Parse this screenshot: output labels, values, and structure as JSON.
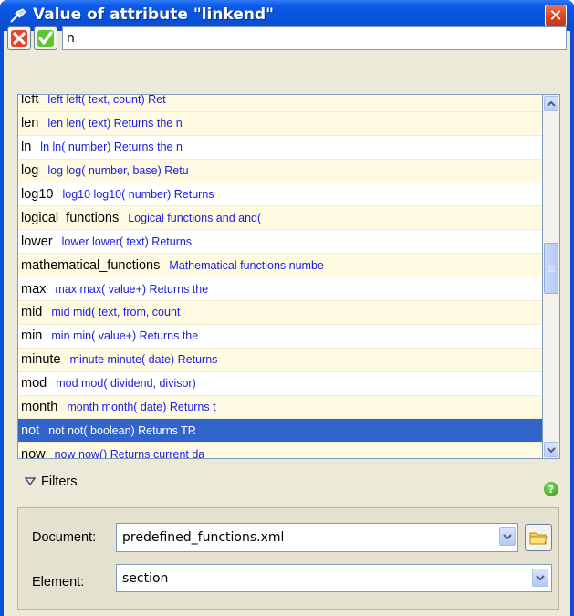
{
  "window": {
    "title": "Value of attribute \"linkend\"",
    "accent": "#0a4fd6",
    "close_glyph": "✕"
  },
  "toolbar": {
    "cancel_icon": "cancel-x-icon",
    "accept_icon": "accept-check-icon",
    "filter_value": "n"
  },
  "list": {
    "items": [
      {
        "name": "left",
        "desc": "left left( text, count) Ret",
        "style": "alt"
      },
      {
        "name": "len",
        "desc": "len len( text) Returns the n",
        "style": "alt"
      },
      {
        "name": "ln",
        "desc": "ln ln( number) Returns the n",
        "style": "plain"
      },
      {
        "name": "log",
        "desc": "log log( number, base) Retu",
        "style": "alt"
      },
      {
        "name": "log10",
        "desc": "log10 log10( number) Returns",
        "style": "plain"
      },
      {
        "name": "logical_functions",
        "desc": "Logical functions and and(",
        "style": "alt"
      },
      {
        "name": "lower",
        "desc": "lower lower( text) Returns",
        "style": "plain"
      },
      {
        "name": "mathematical_functions",
        "desc": "Mathematical functions numbe",
        "style": "alt"
      },
      {
        "name": "max",
        "desc": "max max( value+) Returns the",
        "style": "plain"
      },
      {
        "name": "mid",
        "desc": "mid mid( text, from, count",
        "style": "alt"
      },
      {
        "name": "min",
        "desc": "min min( value+) Returns the",
        "style": "plain"
      },
      {
        "name": "minute",
        "desc": "minute minute( date) Returns",
        "style": "alt"
      },
      {
        "name": "mod",
        "desc": "mod mod( dividend, divisor)",
        "style": "plain"
      },
      {
        "name": "month",
        "desc": "month month( date) Returns t",
        "style": "alt"
      },
      {
        "name": "not",
        "desc": "not not( boolean) Returns TR",
        "style": "selected"
      },
      {
        "name": "now",
        "desc": "now now() Returns current da",
        "style": "alt"
      }
    ],
    "selected_color": "#3165c9",
    "desc_color": "#1b1be0"
  },
  "filters": {
    "label": "Filters",
    "expander_icon": "triangle-down-icon",
    "help_icon": "help-question-icon",
    "help_glyph": "?",
    "document_label": "Document:",
    "document_value": "predefined_functions.xml",
    "browse_icon": "folder-icon",
    "element_label": "Element:",
    "element_value": "section"
  }
}
